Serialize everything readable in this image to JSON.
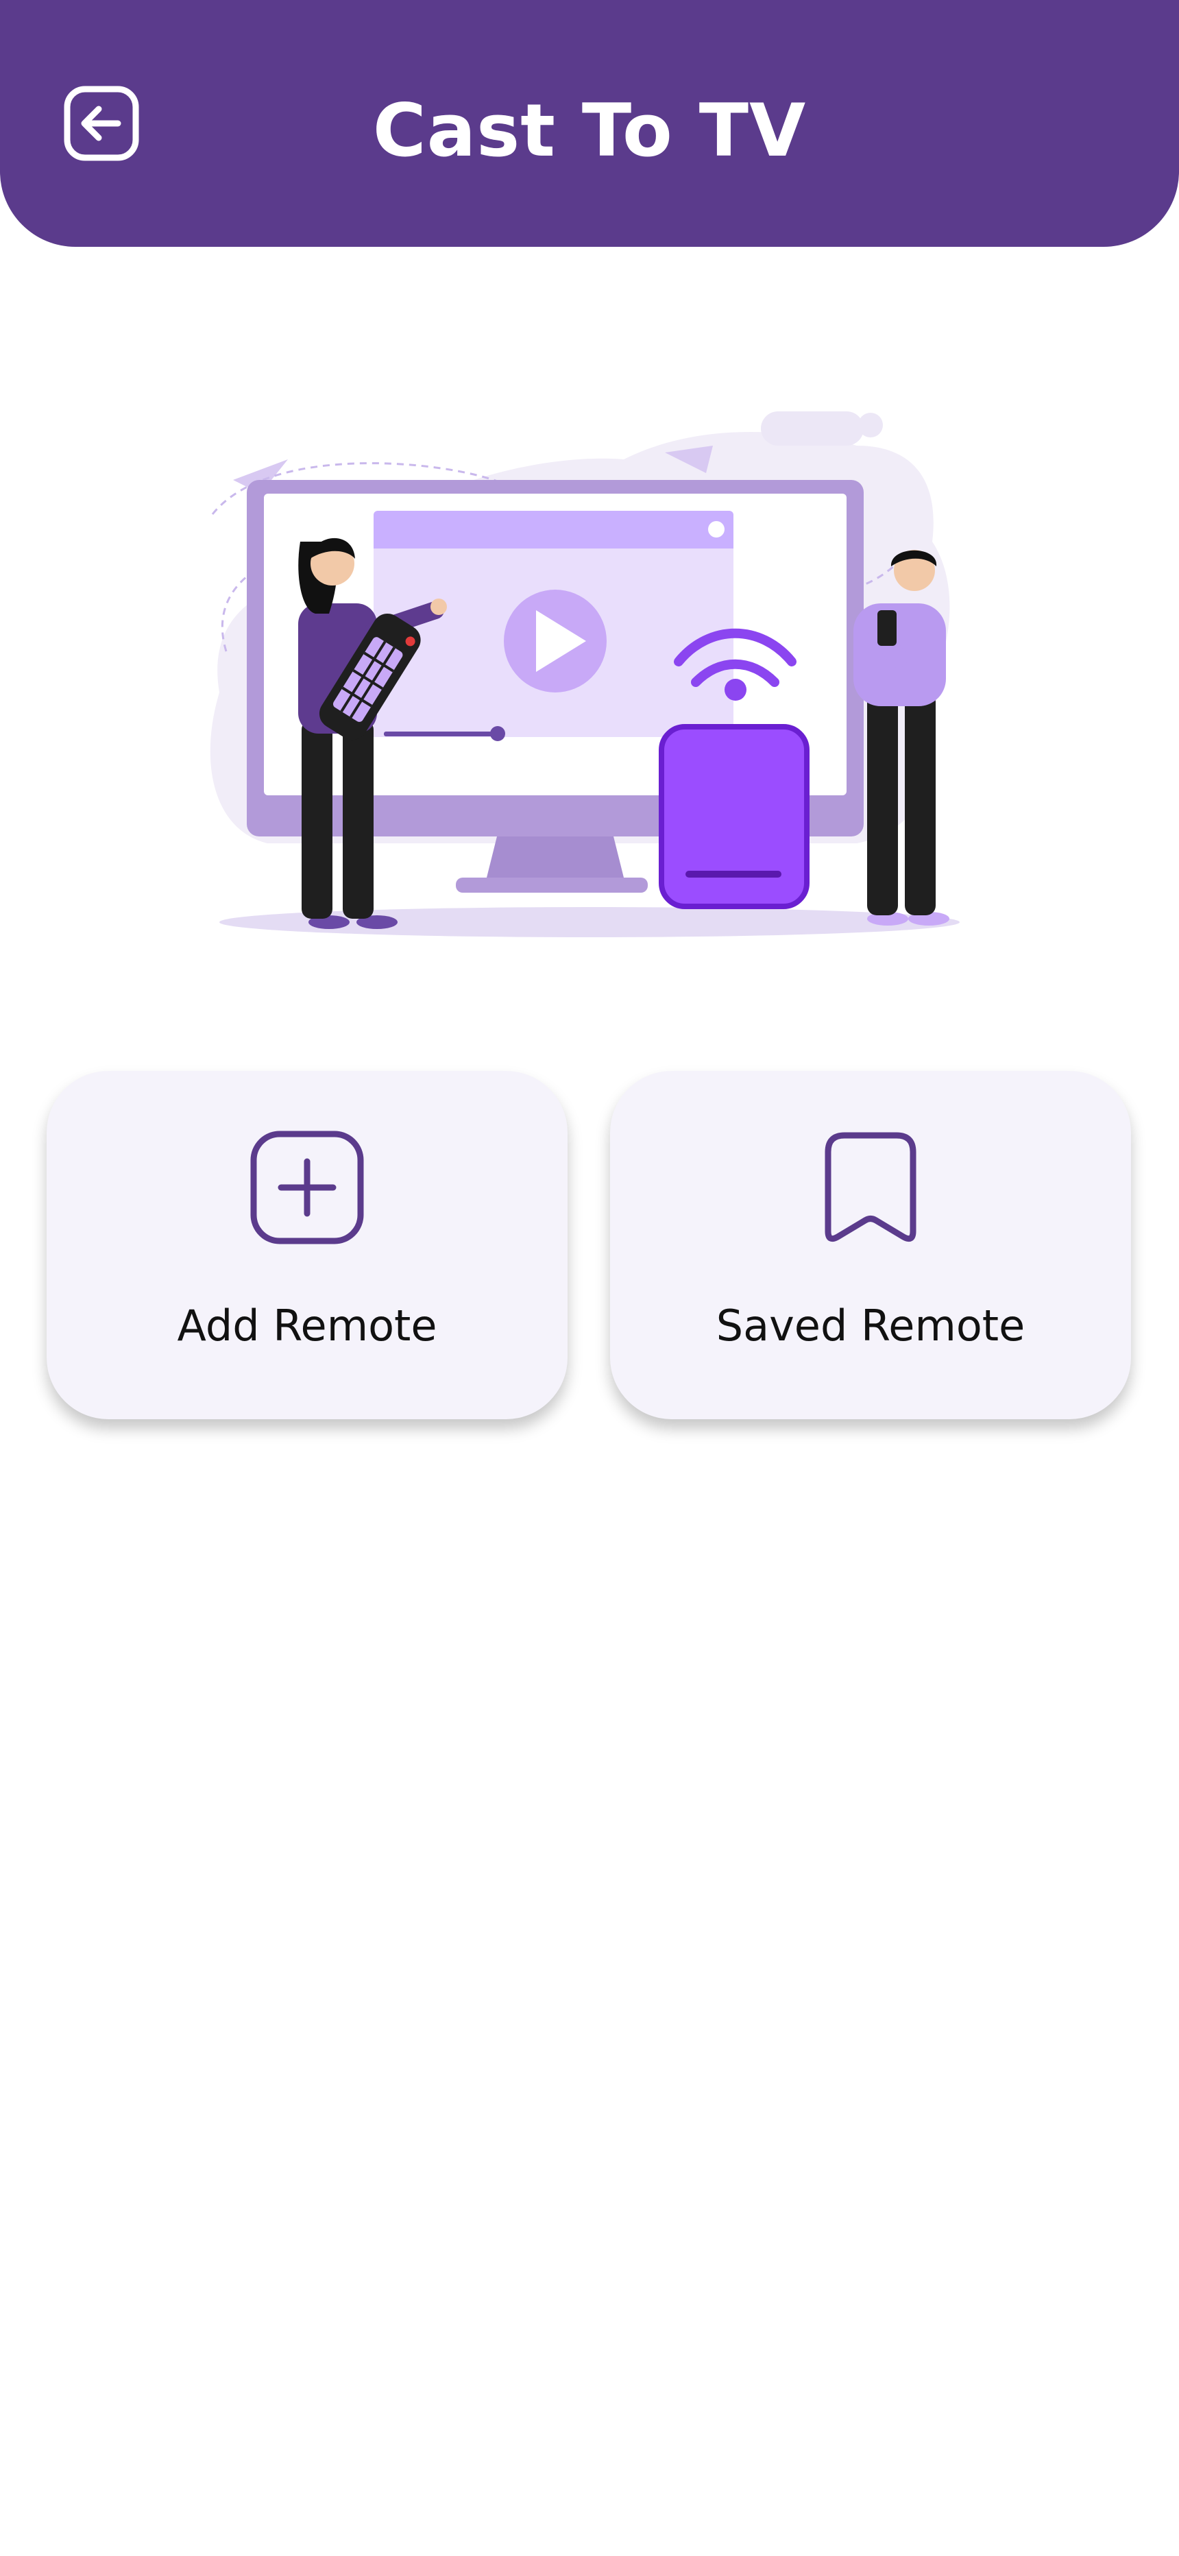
{
  "header": {
    "title": "Cast To TV",
    "back_icon": "back-arrow-icon"
  },
  "illustration": {
    "name": "cast-to-tv-illustration"
  },
  "cards": {
    "add": {
      "label": "Add Remote",
      "icon": "add-square-icon"
    },
    "saved": {
      "label": "Saved Remote",
      "icon": "bookmark-icon"
    }
  },
  "colors": {
    "brand": "#5b3b8c",
    "card_bg": "#f5f3fb",
    "icon": "#5b3b8c",
    "accent": "#9b4dff"
  }
}
